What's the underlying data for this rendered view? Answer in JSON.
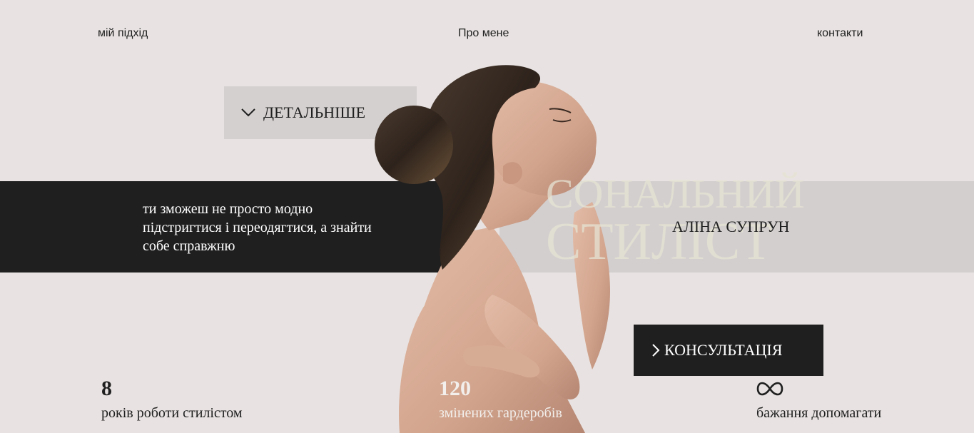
{
  "nav": {
    "approach": "мій підхід",
    "about": "Про мене",
    "contacts": "контакти"
  },
  "hero": {
    "details_label": "ДЕТАЛЬНІШЕ",
    "tagline": "ти зможеш не просто модно підстригтися і переодягтися, а знайти собе справжню",
    "bg_line1": "СОНАЛЬНИЙ",
    "bg_line2": "СТИЛІСТ",
    "stylist_name": "АЛІНА СУПРУН",
    "consult_label": "КОНСУЛЬТАЦІЯ"
  },
  "stats": [
    {
      "value": "8",
      "label": "років роботи стилістом"
    },
    {
      "value": "120",
      "label": "змінених гардеробів"
    },
    {
      "icon": "infinity-icon",
      "label": "бажання допомагати"
    }
  ],
  "colors": {
    "background": "#e8e3e2",
    "dark": "#1f1f1f",
    "light_panel": "#d4d0cf"
  }
}
